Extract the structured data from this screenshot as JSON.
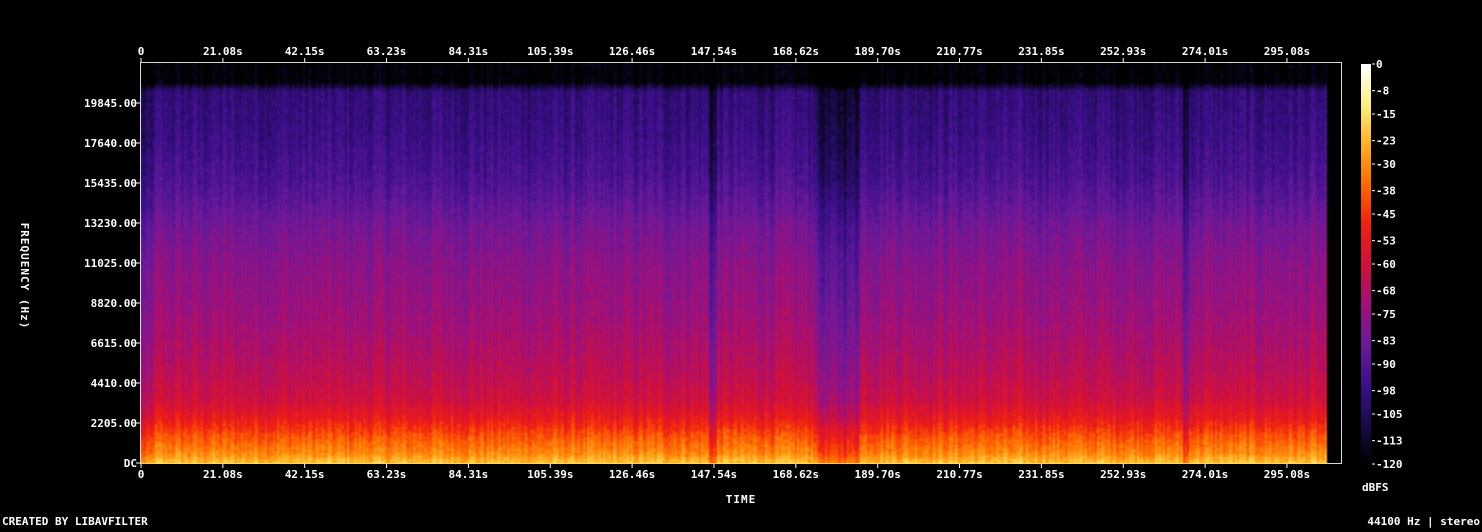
{
  "chart_data": {
    "type": "heatmap",
    "xlabel": "TIME",
    "ylabel": "FREQUENCY (Hz)",
    "x_ticks": [
      "0",
      "21.08s",
      "42.15s",
      "63.23s",
      "84.31s",
      "105.39s",
      "126.46s",
      "147.54s",
      "168.62s",
      "189.70s",
      "210.77s",
      "231.85s",
      "252.93s",
      "274.01s",
      "295.08s"
    ],
    "x_tick_values": [
      0,
      21.08,
      42.15,
      63.23,
      84.31,
      105.39,
      126.46,
      147.54,
      168.62,
      189.7,
      210.77,
      231.85,
      252.93,
      274.01,
      295.08
    ],
    "xlim": [
      0,
      309
    ],
    "y_ticks": [
      "DC",
      "2205.00",
      "4410.00",
      "6615.00",
      "8820.00",
      "11025.00",
      "13230.00",
      "15435.00",
      "17640.00",
      "19845.00"
    ],
    "y_tick_values": [
      0,
      2205,
      4410,
      6615,
      8820,
      11025,
      13230,
      15435,
      17640,
      19845
    ],
    "ylim": [
      0,
      22050
    ],
    "colorbar": {
      "label": "dBFS",
      "ticks": [
        "0",
        "-8",
        "-15",
        "-23",
        "-30",
        "-38",
        "-45",
        "-53",
        "-60",
        "-68",
        "-75",
        "-83",
        "-90",
        "-98",
        "-105",
        "-113",
        "-120"
      ],
      "tick_values": [
        0,
        -8,
        -15,
        -23,
        -30,
        -38,
        -45,
        -53,
        -60,
        -68,
        -75,
        -83,
        -90,
        -98,
        -105,
        -113,
        -120
      ],
      "range": [
        -120,
        0
      ],
      "colors": [
        "#000000",
        "#1a0a4a",
        "#3c0f8c",
        "#6a1a9a",
        "#a0107a",
        "#d0103c",
        "#f02010",
        "#ff6a00",
        "#ffb020",
        "#fff080",
        "#ffffff"
      ]
    },
    "audio_end_seconds": 305.5,
    "quiet_sections_seconds": [
      [
        146.5,
        148.5
      ],
      [
        174.0,
        185.0
      ],
      [
        268.5,
        270.0
      ]
    ],
    "band_levels_dbfs": {
      "freq_hz": [
        0,
        500,
        1500,
        2500,
        3500,
        5000,
        7000,
        9000,
        11000,
        13000,
        14500,
        16000,
        18000,
        20500,
        21000
      ],
      "level": [
        -20,
        -30,
        -40,
        -52,
        -60,
        -65,
        -70,
        -74,
        -77,
        -82,
        -88,
        -93,
        -97,
        -100,
        -120
      ]
    }
  },
  "footer": {
    "left": "CREATED BY LIBAVFILTER",
    "right": "44100 Hz | stereo"
  }
}
